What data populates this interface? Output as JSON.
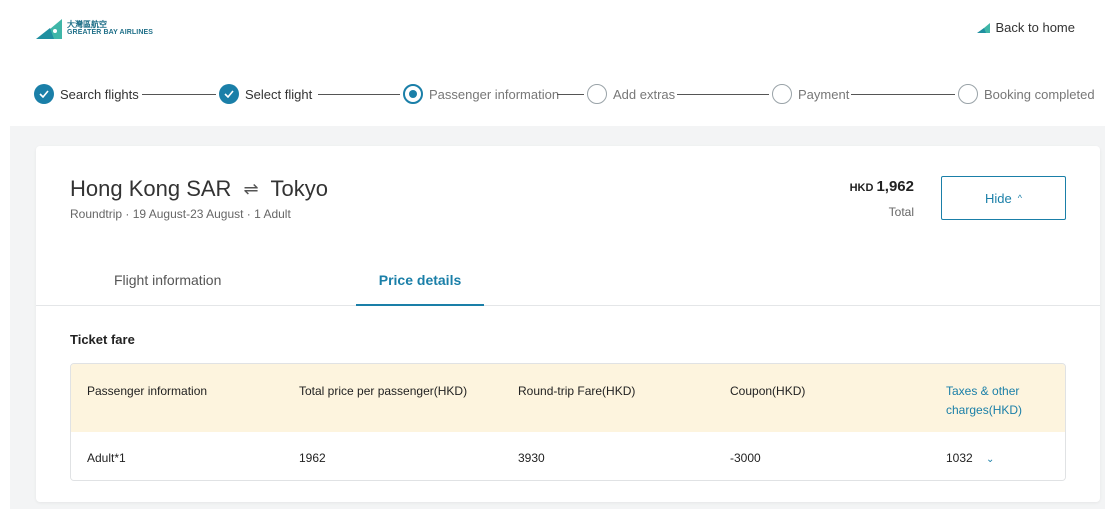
{
  "header": {
    "logo_cn": "大灣區航空",
    "logo_en": "GREATER BAY AIRLINES",
    "back_home": "Back to home"
  },
  "steps": [
    {
      "label": "Search flights",
      "state": "done"
    },
    {
      "label": "Select flight",
      "state": "done"
    },
    {
      "label": "Passenger information",
      "state": "current"
    },
    {
      "label": "Add extras",
      "state": "todo"
    },
    {
      "label": "Payment",
      "state": "todo"
    },
    {
      "label": "Booking completed",
      "state": "todo"
    }
  ],
  "summary": {
    "origin": "Hong Kong SAR",
    "swap_symbol": "⇌",
    "destination": "Tokyo",
    "trip_info": "Roundtrip · 19 August-23 August · 1 Adult",
    "currency": "HKD",
    "price": "1,962",
    "price_label": "Total",
    "hide_label": "Hide",
    "hide_caret": "^"
  },
  "tabs": {
    "flight_info": "Flight information",
    "price_details": "Price details"
  },
  "ticket_fare": {
    "title": "Ticket fare",
    "headers": {
      "passenger": "Passenger information",
      "total": "Total price per passenger(HKD)",
      "fare": "Round-trip Fare(HKD)",
      "coupon": "Coupon(HKD)",
      "taxes_line1": "Taxes & other",
      "taxes_line2": "charges(HKD)"
    },
    "row": {
      "passenger": "Adult*1",
      "total": "1962",
      "fare": "3930",
      "coupon": "-3000",
      "taxes": "1032"
    }
  },
  "colors": {
    "accent": "#1a7fa8",
    "table_header_bg": "#fdf4de",
    "page_bg": "#f3f4f5"
  }
}
